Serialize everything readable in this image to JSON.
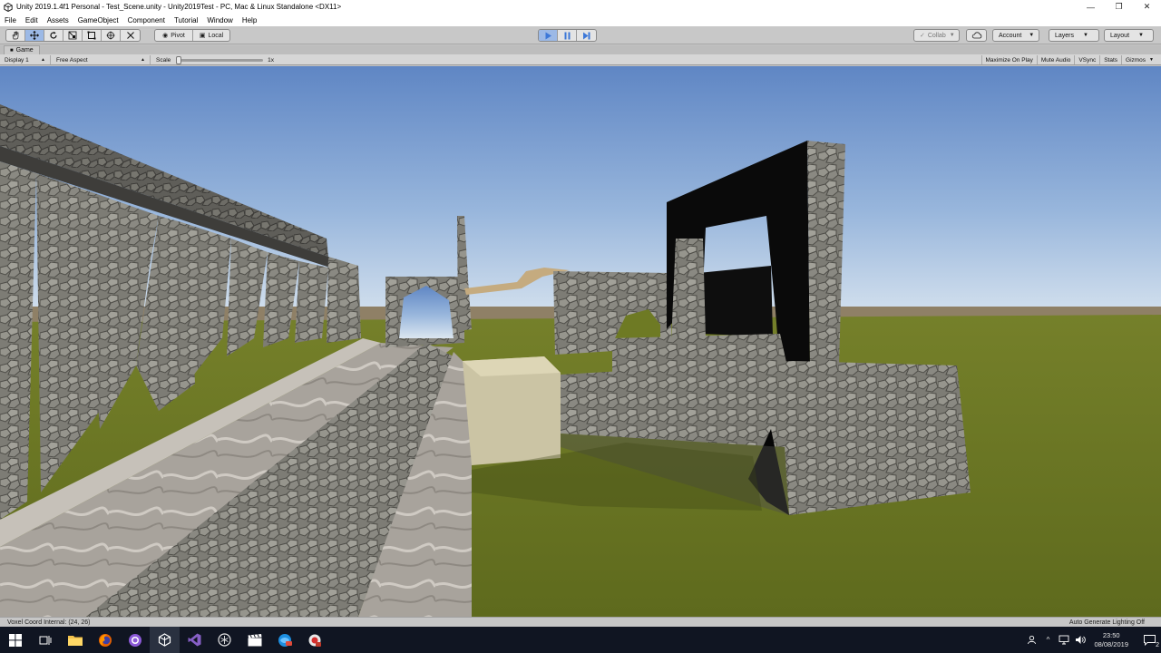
{
  "window": {
    "title": "Unity 2019.1.4f1 Personal - Test_Scene.unity - Unity2019Test - PC, Mac & Linux Standalone <DX11>"
  },
  "menu": [
    "File",
    "Edit",
    "Assets",
    "GameObject",
    "Component",
    "Tutorial",
    "Window",
    "Help"
  ],
  "toolbar": {
    "pivot_label": "Pivot",
    "local_label": "Local",
    "collab_label": "Collab",
    "account_label": "Account",
    "layers_label": "Layers",
    "layout_label": "Layout"
  },
  "game_tab": {
    "label": "Game",
    "display": "Display 1",
    "aspect": "Free Aspect",
    "scale_label": "Scale",
    "scale_value": "1x",
    "options": [
      "Maximize On Play",
      "Mute Audio",
      "VSync",
      "Stats",
      "Gizmos"
    ]
  },
  "status": {
    "left": "Voxel Coord Internal: (24, 26)",
    "right": "Auto Generate Lighting Off"
  },
  "taskbar": {
    "time": "23:50",
    "date": "08/08/2019",
    "notification_count": "2"
  },
  "colors": {
    "sky_top": "#5f86c4",
    "sky_horizon": "#dbe6f0",
    "grass": "#6e7a22",
    "stone": "#8a8a84",
    "play_accent": "#3d78d8"
  }
}
